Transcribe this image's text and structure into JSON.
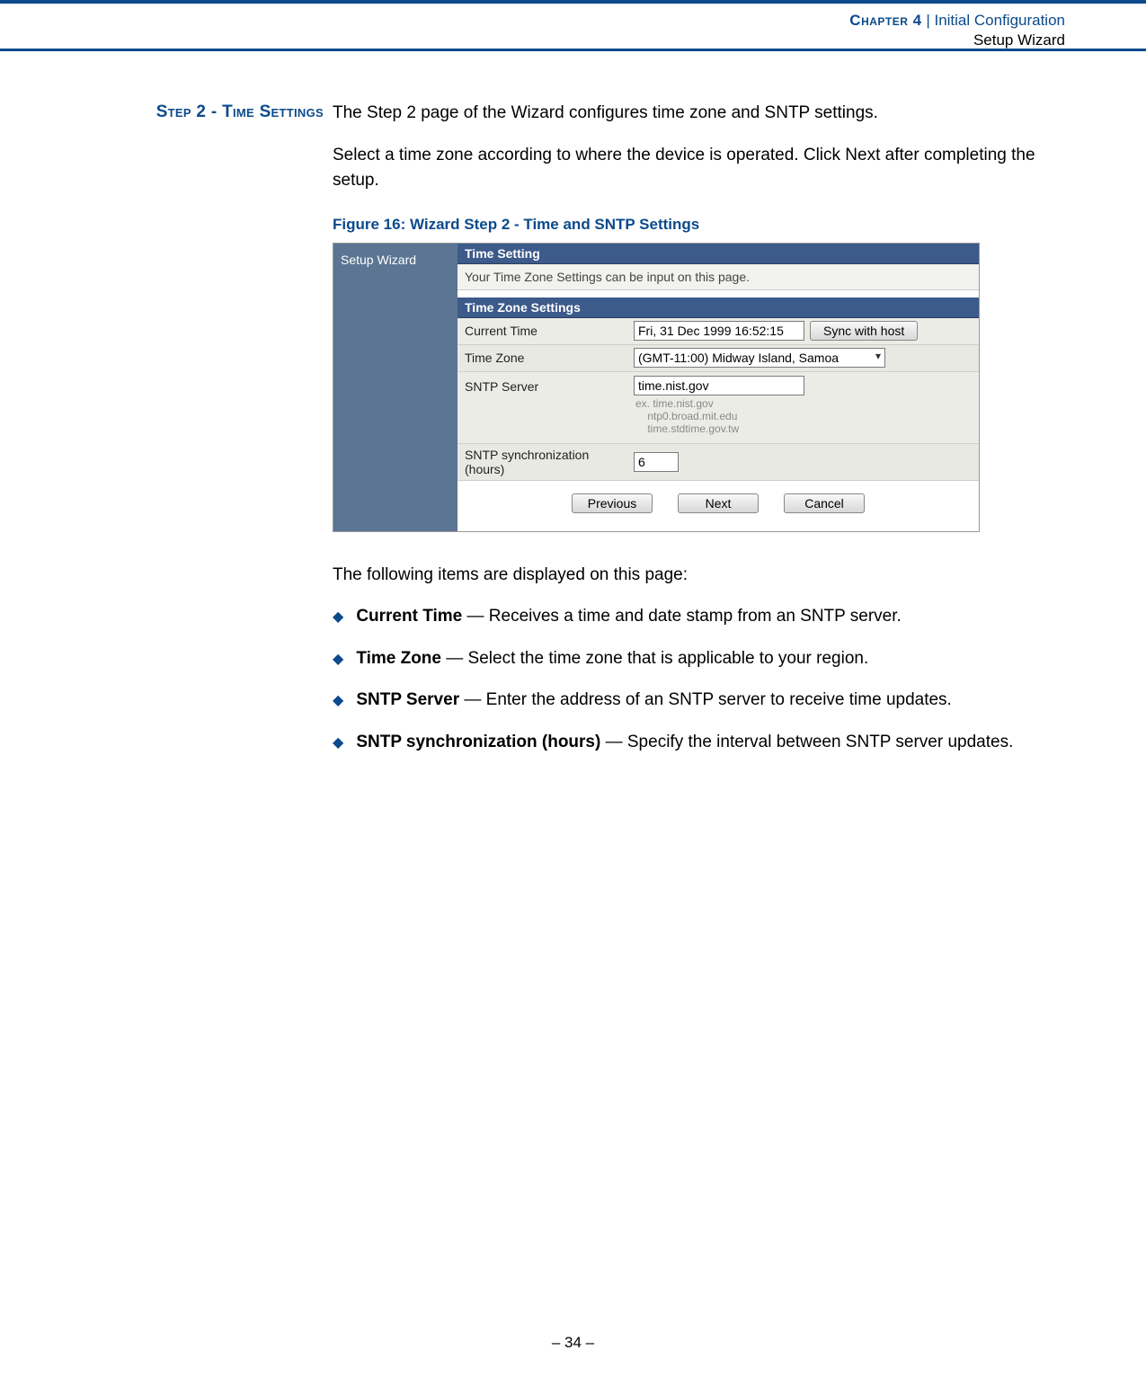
{
  "header": {
    "chapter_label": "Chapter 4",
    "separator": "  |  ",
    "chapter_title": "Initial Configuration",
    "chapter_subtitle": "Setup Wizard"
  },
  "section_label": "Step 2 - Time Settings",
  "paragraphs": {
    "p1": "The Step 2 page of the Wizard configures time zone and SNTP settings.",
    "p2": "Select a time zone according to where the device is operated. Click Next after completing the setup."
  },
  "figure": {
    "caption": "Figure 16:  Wizard Step 2 - Time and SNTP Settings",
    "side_label": "Setup Wizard",
    "panel1_title": "Time Setting",
    "panel1_sub": "Your Time Zone Settings can be input on this page.",
    "panel2_title": "Time Zone Settings",
    "rows": {
      "current_time_label": "Current Time",
      "current_time_value": "Fri, 31 Dec 1999 16:52:15",
      "sync_btn": "Sync with host",
      "time_zone_label": "Time Zone",
      "time_zone_value": "(GMT-11:00) Midway Island, Samoa",
      "sntp_server_label": "SNTP Server",
      "sntp_server_value": "time.nist.gov",
      "sntp_server_hint": "ex. time.nist.gov\n    ntp0.broad.mit.edu\n    time.stdtime.gov.tw",
      "sntp_sync_label": "SNTP synchronization (hours)",
      "sntp_sync_value": "6"
    },
    "buttons": {
      "previous": "Previous",
      "next": "Next",
      "cancel": "Cancel"
    }
  },
  "below_text": "The following items are displayed on this page:",
  "bullets": [
    {
      "term": "Current Time",
      "desc": " — Receives a time and date stamp from an SNTP server."
    },
    {
      "term": "Time Zone",
      "desc": " —  Select the time zone that is applicable to your region."
    },
    {
      "term": "SNTP Server",
      "desc": " — Enter the address of an SNTP server to receive time updates."
    },
    {
      "term": "SNTP synchronization (hours)",
      "desc": " — Specify the interval between SNTP server updates."
    }
  ],
  "footer": "–  34  –"
}
